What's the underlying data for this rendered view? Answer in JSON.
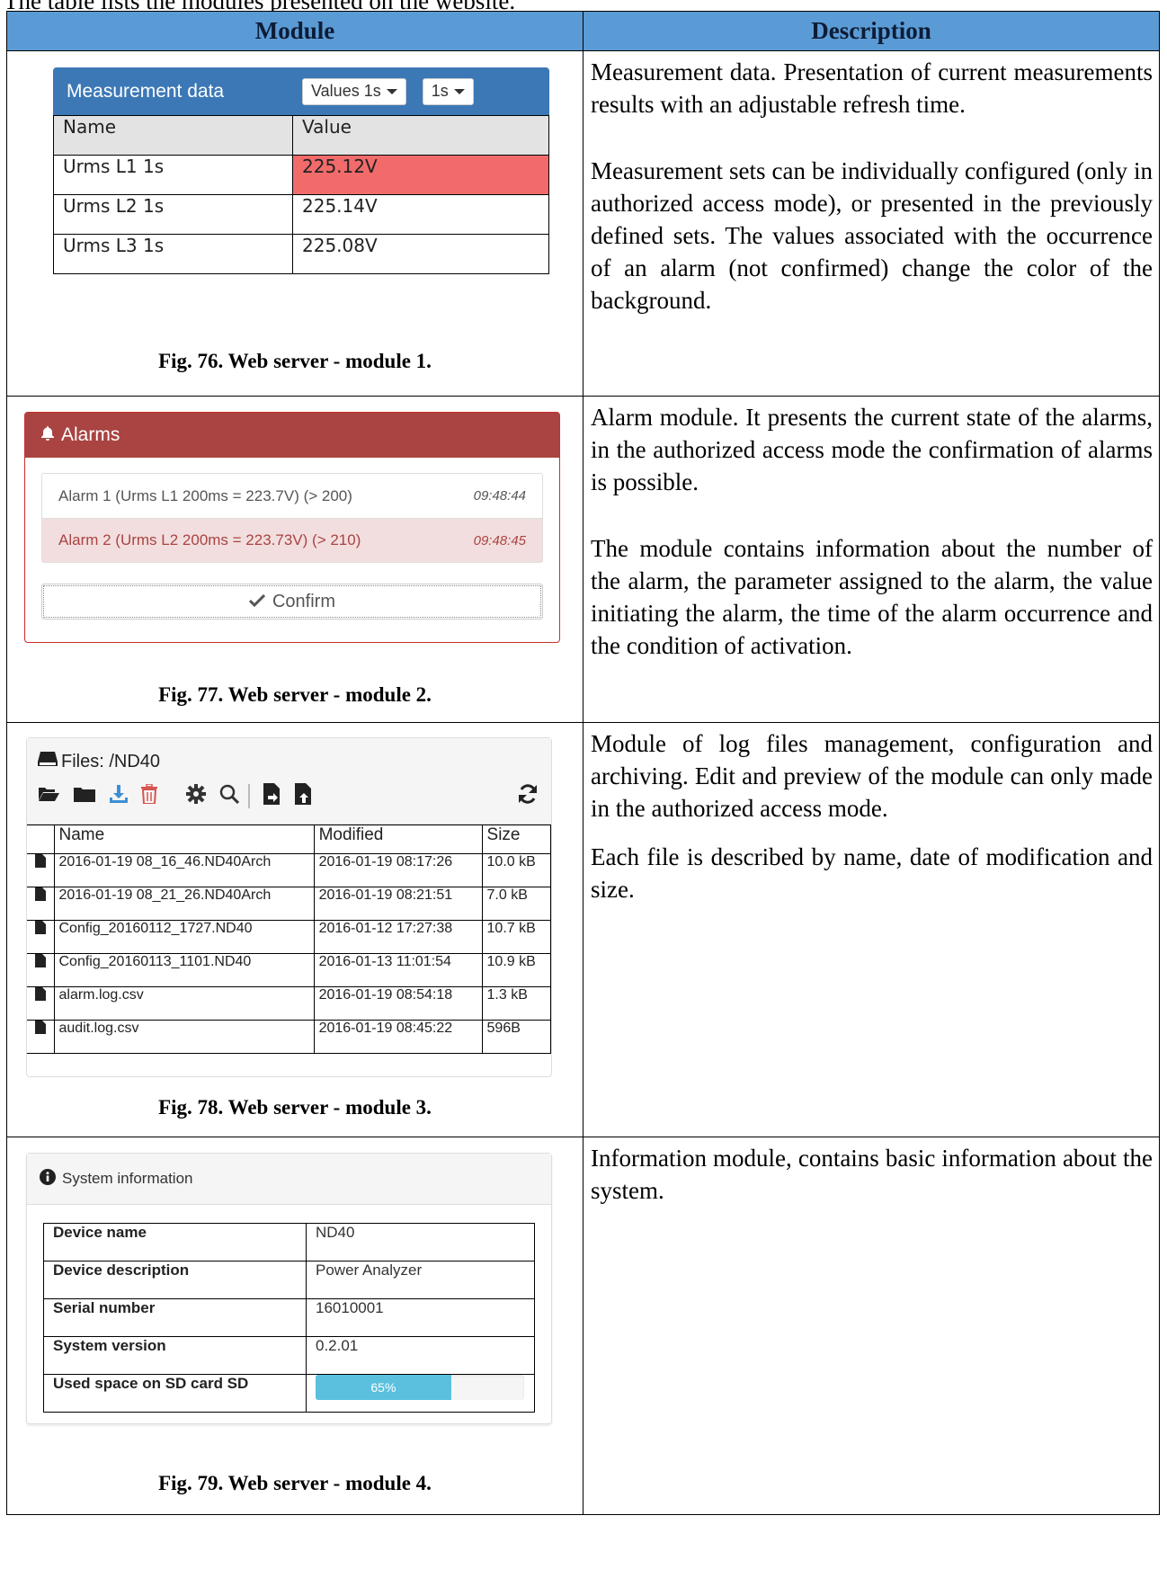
{
  "intro": "The table lists the modules presented on the website.",
  "table": {
    "col_module": "Module",
    "col_description": "Description"
  },
  "rows": [
    {
      "caption": "Fig. 76. Web server - module 1.",
      "desc": [
        "Measurement data. Presentation of current measurements results with an adjustable refresh time.",
        "Measurement sets can be individually configured (only in authorized access mode), or presented in the previously defined sets. The values associated with the occurrence of an alarm (not confirmed) change the color of the background."
      ]
    },
    {
      "caption": "Fig. 77. Web server - module 2.",
      "desc": [
        "Alarm module. It presents the current state of the alarms, in the authorized access mode the confirmation of alarms is possible.",
        "The module contains information about the number of the alarm, the parameter assigned to the alarm, the value initiating the alarm, the time of the alarm occurrence and the condition of activation."
      ]
    },
    {
      "caption": "Fig. 78. Web server - module 3.",
      "desc": [
        "Module of log files management, configuration and archiving. Edit and preview of the module can only made in the authorized access mode.",
        "Each file is described by name, date of modification and size."
      ]
    },
    {
      "caption": "Fig. 79. Web server - module 4.",
      "desc": [
        "Information module, contains basic information about the system."
      ]
    }
  ],
  "module1": {
    "title": "Measurement data",
    "dropdown_set": "Values 1s",
    "dropdown_refresh": "1s",
    "col_name": "Name",
    "col_value": "Value",
    "rows": [
      {
        "name": "Urms L1 1s",
        "value": "225.12V",
        "alarm": true
      },
      {
        "name": "Urms L2 1s",
        "value": "225.14V",
        "alarm": false
      },
      {
        "name": "Urms L3 1s",
        "value": "225.08V",
        "alarm": false
      }
    ],
    "alarm_color": "#f26b6b",
    "header_color": "#3c78b6"
  },
  "module2": {
    "title": "Alarms",
    "alarms": [
      {
        "text": "Alarm 1 (Urms L1 200ms = 223.7V) (> 200)",
        "time": "09:48:44"
      },
      {
        "text": "Alarm 2 (Urms L2 200ms = 223.73V) (> 210)",
        "time": "09:48:45"
      }
    ],
    "confirm_label": "Confirm",
    "header_color": "#a94442"
  },
  "module3": {
    "title": "Files: /ND40",
    "col_name": "Name",
    "col_modified": "Modified",
    "col_size": "Size",
    "files": [
      {
        "name": "2016-01-19 08_16_46.ND40Arch",
        "modified": "2016-01-19 08:17:26",
        "size": "10.0 kB"
      },
      {
        "name": "2016-01-19 08_21_26.ND40Arch",
        "modified": "2016-01-19 08:21:51",
        "size": "7.0 kB"
      },
      {
        "name": "Config_20160112_1727.ND40",
        "modified": "2016-01-12 17:27:38",
        "size": "10.7 kB"
      },
      {
        "name": "Config_20160113_1101.ND40",
        "modified": "2016-01-13 11:01:54",
        "size": "10.9 kB"
      },
      {
        "name": "alarm.log.csv",
        "modified": "2016-01-19 08:54:18",
        "size": "1.3 kB"
      },
      {
        "name": "audit.log.csv",
        "modified": "2016-01-19 08:45:22",
        "size": "596B"
      }
    ],
    "toolbar_icons": [
      "folder-open-icon",
      "folder-icon",
      "download-icon",
      "trash-icon",
      "gear-icon",
      "search-icon",
      "file-import-icon",
      "file-export-icon",
      "refresh-icon"
    ]
  },
  "module4": {
    "title": "System information",
    "rows": [
      {
        "key": "Device name",
        "value": "ND40"
      },
      {
        "key": "Device description",
        "value": "Power Analyzer"
      },
      {
        "key": "Serial number",
        "value": "16010001"
      },
      {
        "key": "System version",
        "value": "0.2.01"
      }
    ],
    "sd_label": "Used space on SD card  SD",
    "sd_used_percent": 65,
    "sd_used_text": "65%",
    "bar_color": "#5bc0de"
  }
}
